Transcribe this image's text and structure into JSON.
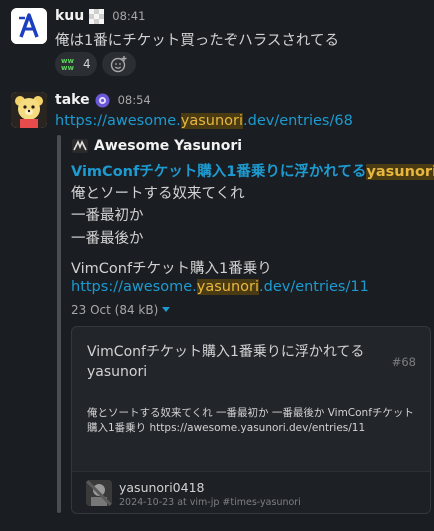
{
  "messages": [
    {
      "author": "kuu",
      "time": "08:41",
      "text": "俺は1番にチケット買ったぞハラスされてる",
      "reaction": {
        "emoji": "www-icon",
        "count": "4"
      }
    },
    {
      "author": "take",
      "time": "08:54",
      "link": {
        "pre": "https://awesome.",
        "hl": "yasunori",
        "post": ".dev/entries/68"
      }
    }
  ],
  "quote": {
    "author": "Awesome Yasunori",
    "title_pre": "VimConfチケット購入1番乗りに浮かれてる",
    "title_hl": "yasunori",
    "lines": [
      "俺とソートする奴来てくれ",
      "一番最初か",
      "一番最後か"
    ],
    "subtitle": "VimConfチケット購入1番乗り",
    "link": {
      "pre": "https://awesome.",
      "hl": "yasunori",
      "post": ".dev/entries/11"
    },
    "meta": "23 Oct (84 kB)"
  },
  "card": {
    "title": "VimConfチケット購入1番乗りに浮かれてる yasunori",
    "number": "#68",
    "description": "俺とソートする奴来てくれ 一番最初か 一番最後か VimConfチケット購入1番乗り https://awesome.yasunori.dev/entries/11",
    "user": "yasunori0418",
    "sub": "2024-10-23 at vim-jp #times-yasunori"
  },
  "colors": {
    "link": "#1d9bd1",
    "highlight": "#e8b73f",
    "background": "#1a1d21"
  }
}
